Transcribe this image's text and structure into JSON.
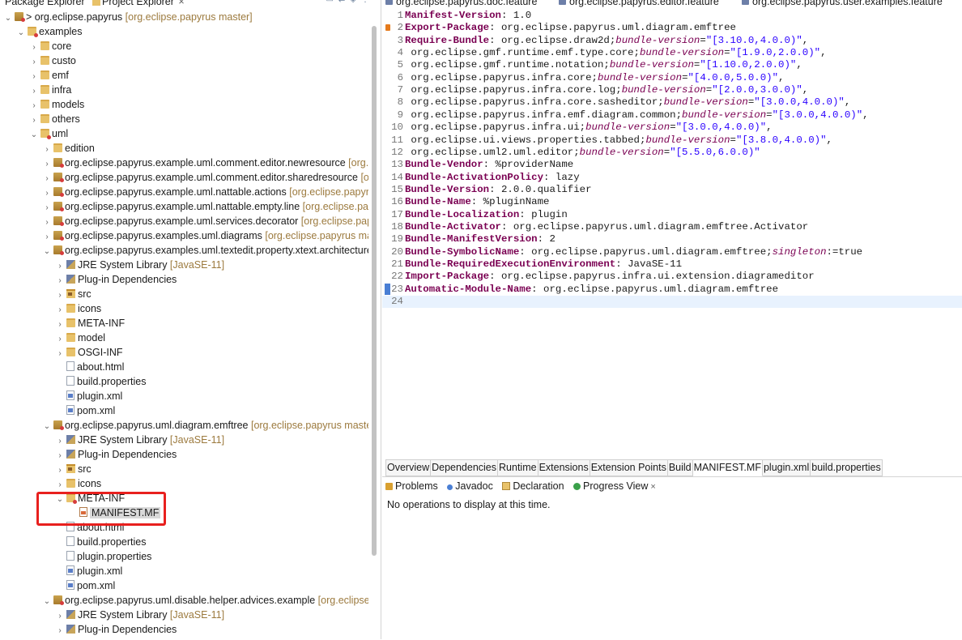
{
  "left_tabs": {
    "package_explorer": "Package Explorer",
    "project_explorer": "Project Explorer",
    "close": "×"
  },
  "tree": [
    {
      "indent": 0,
      "arrow": "⌄",
      "icon": "proj",
      "label": "> org.eclipse.papyrus",
      "dec": " [org.eclipse.papyrus master]"
    },
    {
      "indent": 1,
      "arrow": "⌄",
      "icon": "folder-red",
      "label": "examples",
      "dec": ""
    },
    {
      "indent": 2,
      "arrow": "›",
      "icon": "folder",
      "label": "core",
      "dec": ""
    },
    {
      "indent": 2,
      "arrow": "›",
      "icon": "folder",
      "label": "custo",
      "dec": ""
    },
    {
      "indent": 2,
      "arrow": "›",
      "icon": "folder",
      "label": "emf",
      "dec": ""
    },
    {
      "indent": 2,
      "arrow": "›",
      "icon": "folder",
      "label": "infra",
      "dec": ""
    },
    {
      "indent": 2,
      "arrow": "›",
      "icon": "folder",
      "label": "models",
      "dec": ""
    },
    {
      "indent": 2,
      "arrow": "›",
      "icon": "folder",
      "label": "others",
      "dec": ""
    },
    {
      "indent": 2,
      "arrow": "⌄",
      "icon": "folder-red",
      "label": "uml",
      "dec": ""
    },
    {
      "indent": 3,
      "arrow": "›",
      "icon": "folder",
      "label": "edition",
      "dec": ""
    },
    {
      "indent": 3,
      "arrow": "›",
      "icon": "proj",
      "label": "org.eclipse.papyrus.example.uml.comment.editor.newresource",
      "dec": " [org.eclipse.papyrus master]"
    },
    {
      "indent": 3,
      "arrow": "›",
      "icon": "proj",
      "label": "org.eclipse.papyrus.example.uml.comment.editor.sharedresource",
      "dec": " [org.eclipse.papyrus master]"
    },
    {
      "indent": 3,
      "arrow": "›",
      "icon": "proj",
      "label": "org.eclipse.papyrus.example.uml.nattable.actions",
      "dec": " [org.eclipse.papyrus master]"
    },
    {
      "indent": 3,
      "arrow": "›",
      "icon": "proj",
      "label": "org.eclipse.papyrus.example.uml.nattable.empty.line",
      "dec": " [org.eclipse.papyrus master]"
    },
    {
      "indent": 3,
      "arrow": "›",
      "icon": "proj",
      "label": "org.eclipse.papyrus.example.uml.services.decorator",
      "dec": " [org.eclipse.papyrus master]"
    },
    {
      "indent": 3,
      "arrow": "›",
      "icon": "proj",
      "label": "org.eclipse.papyrus.examples.uml.diagrams",
      "dec": " [org.eclipse.papyrus master]"
    },
    {
      "indent": 3,
      "arrow": "⌄",
      "icon": "proj",
      "label": "org.eclipse.papyrus.examples.uml.textedit.property.xtext.architecture",
      "dec": ""
    },
    {
      "indent": 4,
      "arrow": "›",
      "icon": "lib",
      "label": "JRE System Library",
      "dec": " [JavaSE-11]"
    },
    {
      "indent": 4,
      "arrow": "›",
      "icon": "lib",
      "label": "Plug-in Dependencies",
      "dec": ""
    },
    {
      "indent": 4,
      "arrow": "›",
      "icon": "src",
      "label": "src",
      "dec": ""
    },
    {
      "indent": 4,
      "arrow": "›",
      "icon": "folder",
      "label": "icons",
      "dec": ""
    },
    {
      "indent": 4,
      "arrow": "›",
      "icon": "folder",
      "label": "META-INF",
      "dec": ""
    },
    {
      "indent": 4,
      "arrow": "›",
      "icon": "folder",
      "label": "model",
      "dec": ""
    },
    {
      "indent": 4,
      "arrow": "›",
      "icon": "folder",
      "label": "OSGI-INF",
      "dec": ""
    },
    {
      "indent": 4,
      "arrow": "",
      "icon": "file",
      "label": "about.html",
      "dec": ""
    },
    {
      "indent": 4,
      "arrow": "",
      "icon": "file",
      "label": "build.properties",
      "dec": ""
    },
    {
      "indent": 4,
      "arrow": "",
      "icon": "xml",
      "label": "plugin.xml",
      "dec": ""
    },
    {
      "indent": 4,
      "arrow": "",
      "icon": "xml",
      "label": "pom.xml",
      "dec": ""
    },
    {
      "indent": 3,
      "arrow": "⌄",
      "icon": "proj",
      "label": "org.eclipse.papyrus.uml.diagram.emftree",
      "dec": " [org.eclipse.papyrus master]"
    },
    {
      "indent": 4,
      "arrow": "›",
      "icon": "lib",
      "label": "JRE System Library",
      "dec": " [JavaSE-11]"
    },
    {
      "indent": 4,
      "arrow": "›",
      "icon": "lib",
      "label": "Plug-in Dependencies",
      "dec": ""
    },
    {
      "indent": 4,
      "arrow": "›",
      "icon": "src",
      "label": "src",
      "dec": ""
    },
    {
      "indent": 4,
      "arrow": "›",
      "icon": "folder",
      "label": "icons",
      "dec": ""
    },
    {
      "indent": 4,
      "arrow": "⌄",
      "icon": "folder-red",
      "label": "META-INF",
      "dec": ""
    },
    {
      "indent": 5,
      "arrow": "",
      "icon": "mf",
      "label": "MANIFEST.MF",
      "dec": "",
      "selected": true
    },
    {
      "indent": 4,
      "arrow": "",
      "icon": "file",
      "label": "about.html",
      "dec": ""
    },
    {
      "indent": 4,
      "arrow": "",
      "icon": "file",
      "label": "build.properties",
      "dec": ""
    },
    {
      "indent": 4,
      "arrow": "",
      "icon": "file",
      "label": "plugin.properties",
      "dec": ""
    },
    {
      "indent": 4,
      "arrow": "",
      "icon": "xml",
      "label": "plugin.xml",
      "dec": ""
    },
    {
      "indent": 4,
      "arrow": "",
      "icon": "xml",
      "label": "pom.xml",
      "dec": ""
    },
    {
      "indent": 3,
      "arrow": "⌄",
      "icon": "proj",
      "label": "org.eclipse.papyrus.uml.disable.helper.advices.example",
      "dec": " [org.eclipse.papyrus master]"
    },
    {
      "indent": 4,
      "arrow": "›",
      "icon": "lib",
      "label": "JRE System Library",
      "dec": " [JavaSE-11]"
    },
    {
      "indent": 4,
      "arrow": "›",
      "icon": "lib",
      "label": "Plug-in Dependencies",
      "dec": ""
    }
  ],
  "editor_tabs": [
    "org.eclipse.papyrus.doc.feature",
    "org.eclipse.papyrus.editor.feature",
    "org.eclipse.papyrus.user.examples.feature"
  ],
  "code_lines": [
    [
      [
        "k",
        "Manifest-Version"
      ],
      [
        "v",
        ": 1.0"
      ]
    ],
    [
      [
        "k",
        "Export-Package"
      ],
      [
        "v",
        ": org.eclipse.papyrus.uml.diagram.emftree"
      ]
    ],
    [
      [
        "k",
        "Require-Bundle"
      ],
      [
        "v",
        ": org.eclipse.draw2d;"
      ],
      [
        "a",
        "bundle-version"
      ],
      [
        "v",
        "="
      ],
      [
        "s",
        "\"[3.10.0,4.0.0)\""
      ],
      [
        "v",
        ","
      ]
    ],
    [
      [
        "v",
        " org.eclipse.gmf.runtime.emf.type.core;"
      ],
      [
        "a",
        "bundle-version"
      ],
      [
        "v",
        "="
      ],
      [
        "s",
        "\"[1.9.0,2.0.0)\""
      ],
      [
        "v",
        ","
      ]
    ],
    [
      [
        "v",
        " org.eclipse.gmf.runtime.notation;"
      ],
      [
        "a",
        "bundle-version"
      ],
      [
        "v",
        "="
      ],
      [
        "s",
        "\"[1.10.0,2.0.0)\""
      ],
      [
        "v",
        ","
      ]
    ],
    [
      [
        "v",
        " org.eclipse.papyrus.infra.core;"
      ],
      [
        "a",
        "bundle-version"
      ],
      [
        "v",
        "="
      ],
      [
        "s",
        "\"[4.0.0,5.0.0)\""
      ],
      [
        "v",
        ","
      ]
    ],
    [
      [
        "v",
        " org.eclipse.papyrus.infra.core.log;"
      ],
      [
        "a",
        "bundle-version"
      ],
      [
        "v",
        "="
      ],
      [
        "s",
        "\"[2.0.0,3.0.0)\""
      ],
      [
        "v",
        ","
      ]
    ],
    [
      [
        "v",
        " org.eclipse.papyrus.infra.core.sasheditor;"
      ],
      [
        "a",
        "bundle-version"
      ],
      [
        "v",
        "="
      ],
      [
        "s",
        "\"[3.0.0,4.0.0)\""
      ],
      [
        "v",
        ","
      ]
    ],
    [
      [
        "v",
        " org.eclipse.papyrus.infra.emf.diagram.common;"
      ],
      [
        "a",
        "bundle-version"
      ],
      [
        "v",
        "="
      ],
      [
        "s",
        "\"[3.0.0,4.0.0)\""
      ],
      [
        "v",
        ","
      ]
    ],
    [
      [
        "v",
        " org.eclipse.papyrus.infra.ui;"
      ],
      [
        "a",
        "bundle-version"
      ],
      [
        "v",
        "="
      ],
      [
        "s",
        "\"[3.0.0,4.0.0)\""
      ],
      [
        "v",
        ","
      ]
    ],
    [
      [
        "v",
        " org.eclipse.ui.views.properties.tabbed;"
      ],
      [
        "a",
        "bundle-version"
      ],
      [
        "v",
        "="
      ],
      [
        "s",
        "\"[3.8.0,4.0.0)\""
      ],
      [
        "v",
        ","
      ]
    ],
    [
      [
        "v",
        " org.eclipse.uml2.uml.editor;"
      ],
      [
        "a",
        "bundle-version"
      ],
      [
        "v",
        "="
      ],
      [
        "s",
        "\"[5.5.0,6.0.0)\""
      ]
    ],
    [
      [
        "k",
        "Bundle-Vendor"
      ],
      [
        "v",
        ": %providerName"
      ]
    ],
    [
      [
        "k",
        "Bundle-ActivationPolicy"
      ],
      [
        "v",
        ": lazy"
      ]
    ],
    [
      [
        "k",
        "Bundle-Version"
      ],
      [
        "v",
        ": 2.0.0.qualifier"
      ]
    ],
    [
      [
        "k",
        "Bundle-Name"
      ],
      [
        "v",
        ": %pluginName"
      ]
    ],
    [
      [
        "k",
        "Bundle-Localization"
      ],
      [
        "v",
        ": plugin"
      ]
    ],
    [
      [
        "k",
        "Bundle-Activator"
      ],
      [
        "v",
        ": org.eclipse.papyrus.uml.diagram.emftree.Activator"
      ]
    ],
    [
      [
        "k",
        "Bundle-ManifestVersion"
      ],
      [
        "v",
        ": 2"
      ]
    ],
    [
      [
        "k",
        "Bundle-SymbolicName"
      ],
      [
        "v",
        ": org.eclipse.papyrus.uml.diagram.emftree;"
      ],
      [
        "a",
        "singleton"
      ],
      [
        "v",
        ":=true"
      ]
    ],
    [
      [
        "k",
        "Bundle-RequiredExecutionEnvironment"
      ],
      [
        "v",
        ": JavaSE-11"
      ]
    ],
    [
      [
        "k",
        "Import-Package"
      ],
      [
        "v",
        ": org.eclipse.papyrus.infra.ui.extension.diagrameditor"
      ]
    ],
    [
      [
        "k",
        "Automatic-Module-Name"
      ],
      [
        "v",
        ": org.eclipse.papyrus.uml.diagram.emftree"
      ]
    ],
    []
  ],
  "manifest_tabs": [
    "Overview",
    "Dependencies",
    "Runtime",
    "Extensions",
    "Extension Points",
    "Build",
    "MANIFEST.MF",
    "plugin.xml",
    "build.properties"
  ],
  "manifest_active": "MANIFEST.MF",
  "view_tabs": {
    "problems": "Problems",
    "javadoc": "Javadoc",
    "declaration": "Declaration",
    "progress": "Progress View",
    "close": "×"
  },
  "view_message": "No operations to display at this time.",
  "colors": {
    "highlight": "#e8201e",
    "keyword": "#7a0052",
    "string": "#2a00ff"
  }
}
